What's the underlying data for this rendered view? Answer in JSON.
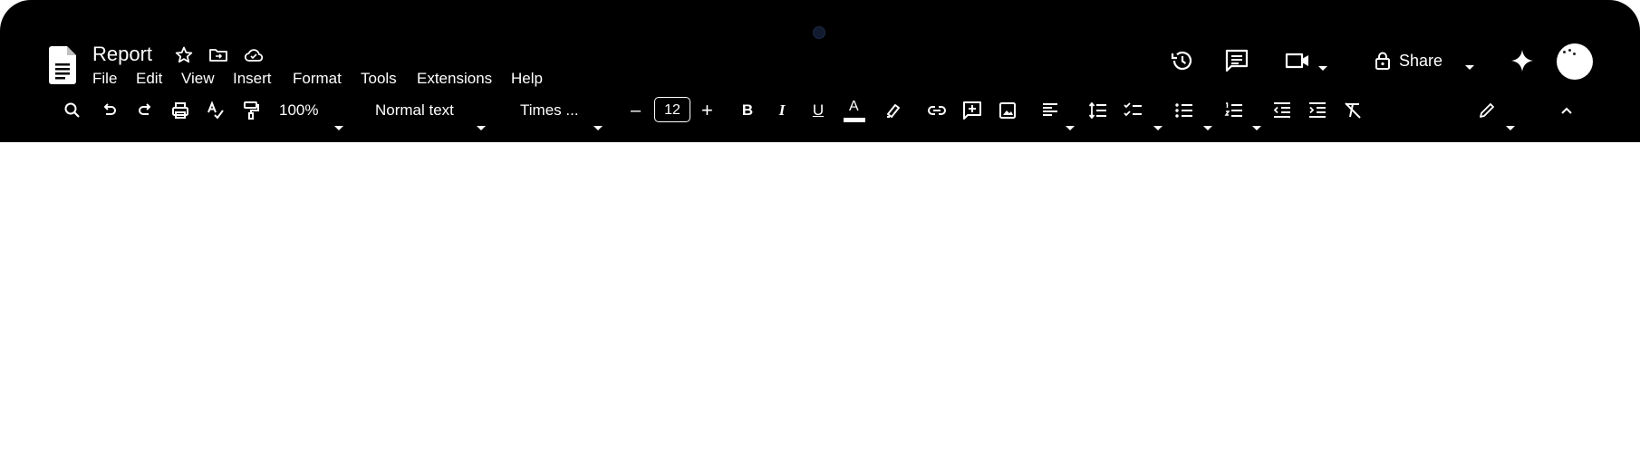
{
  "document": {
    "title": "Report"
  },
  "menu": [
    {
      "label": "File"
    },
    {
      "label": "Edit"
    },
    {
      "label": "View"
    },
    {
      "label": "Insert"
    },
    {
      "label": "Format"
    },
    {
      "label": "Tools"
    },
    {
      "label": "Extensions"
    },
    {
      "label": "Help"
    }
  ],
  "header": {
    "share_label": "Share",
    "icons": [
      "version-history-icon",
      "comments-icon",
      "meet-icon",
      "lock-icon",
      "gemini-sparkle-icon"
    ]
  },
  "toolbar": {
    "zoom": "100%",
    "paragraph_style": "Normal text",
    "font_family": "Times ...",
    "font_size": "12",
    "font_size_decrease": "–",
    "font_size_increase": "+",
    "bold": "B",
    "italic": "I",
    "underline": "U",
    "text_color": "A"
  },
  "colors": {
    "chrome_background": "#000000",
    "foreground": "#ffffff",
    "page_background": "#ffffff"
  }
}
